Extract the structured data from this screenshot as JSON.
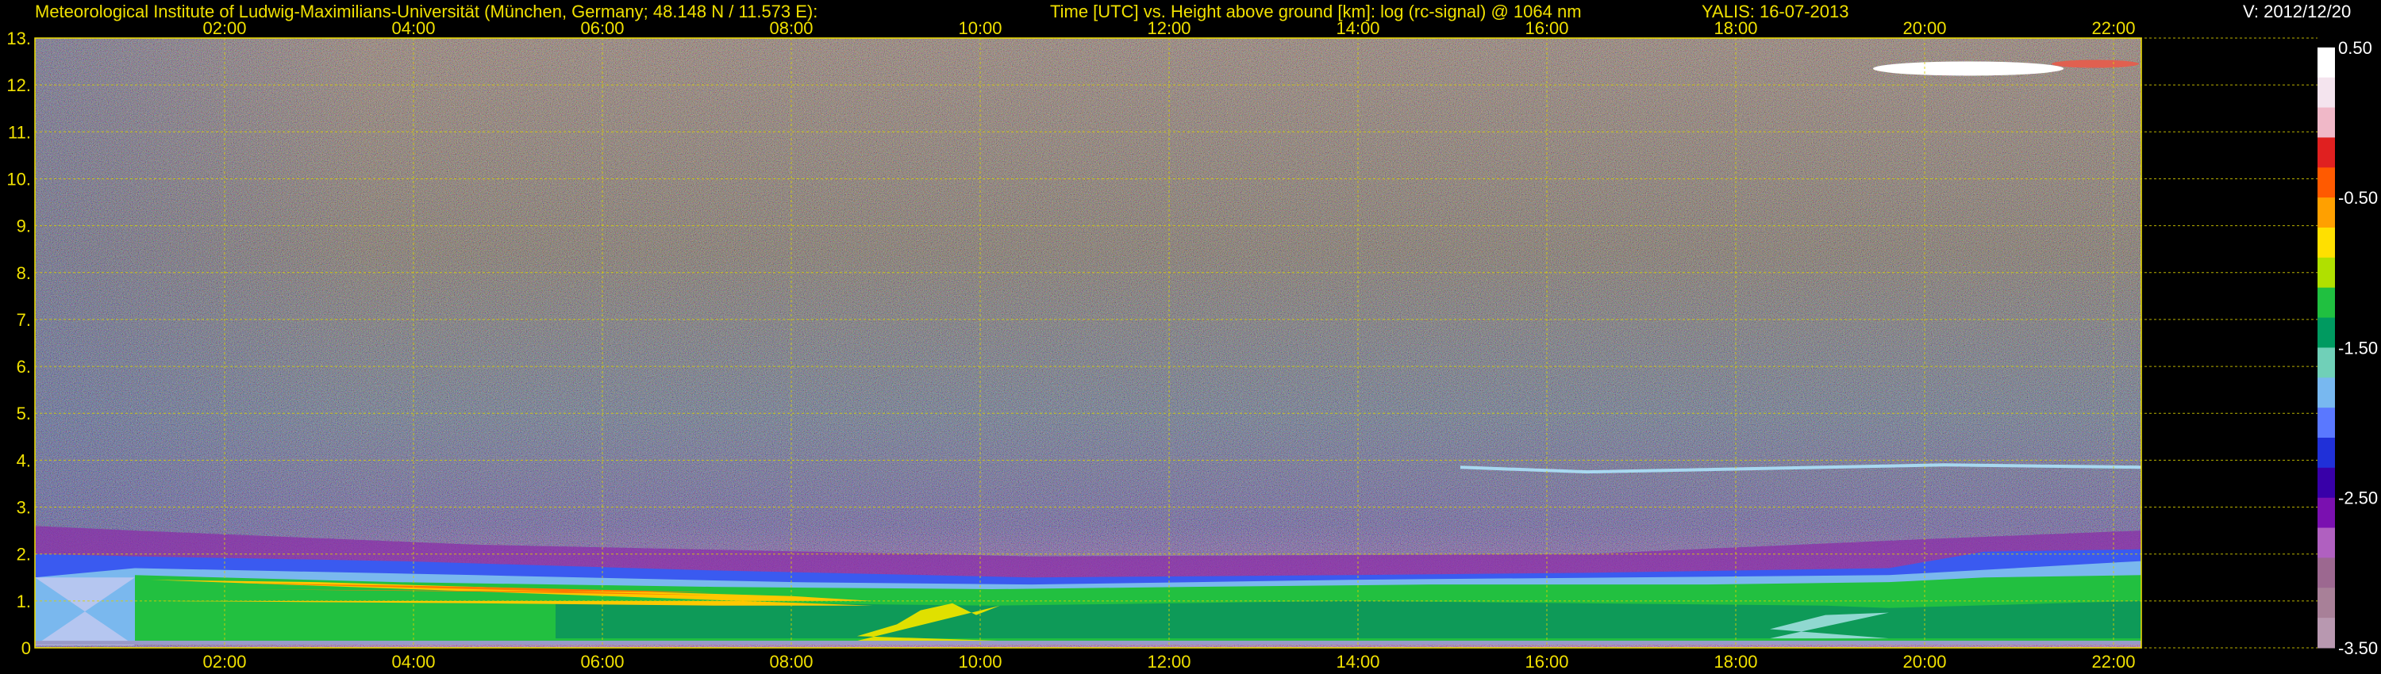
{
  "header": {
    "institute": "Meteorological Institute of Ludwig-Maximilians-Universität (München, Germany; 48.148 N / 11.573 E):",
    "plot_desc": "Time [UTC] vs. Height above ground [km]: log (rc-signal) @ 1064 nm",
    "instrument": "YALIS: 16-07-2013",
    "version": "V: 2012/12/20"
  },
  "colors": {
    "axis": "#f0e000",
    "grid": "#d8d000",
    "background": "#000000"
  },
  "chart_data": {
    "type": "heatmap",
    "x_ticks": [
      "02:00",
      "04:00",
      "06:00",
      "08:00",
      "10:00",
      "12:00",
      "14:00",
      "16:00",
      "18:00",
      "20:00",
      "22:00"
    ],
    "y_ticks": [
      "0",
      "1.",
      "2.",
      "3.",
      "4.",
      "5.",
      "6.",
      "7.",
      "8.",
      "9.",
      "10.",
      "11.",
      "12.",
      "13."
    ],
    "ylim": [
      0,
      13
    ],
    "grid": true,
    "colorbar": {
      "ticks": [
        "0.50",
        "-0.50",
        "-1.50",
        "-2.50",
        "-3.50"
      ],
      "range": [
        -3.5,
        0.5
      ],
      "colors": [
        "#ffffff",
        "#f4e4ee",
        "#f0b8c8",
        "#e02020",
        "#ff5a00",
        "#ffa000",
        "#ffe000",
        "#b0e000",
        "#20c040",
        "#009a60",
        "#70d0b8",
        "#78b8f0",
        "#5a78ff",
        "#2030d8",
        "#3800a8",
        "#7a10b0",
        "#b060c0",
        "#9c6890",
        "#a88098",
        "#b898b0"
      ]
    }
  }
}
